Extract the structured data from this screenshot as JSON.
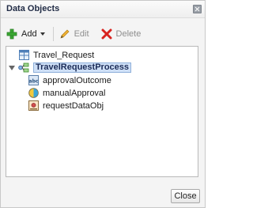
{
  "dialog": {
    "title": "Data Objects"
  },
  "toolbar": {
    "add_label": "Add",
    "edit_label": "Edit",
    "delete_label": "Delete"
  },
  "tree": {
    "items": [
      {
        "label": "Travel_Request",
        "icon": "table-icon",
        "level": 0
      },
      {
        "label": "TravelRequestProcess",
        "icon": "process-icon",
        "level": 0,
        "expanded": true,
        "selected": true
      },
      {
        "label": "approvalOutcome",
        "icon": "string-var-icon",
        "level": 1
      },
      {
        "label": "manualApproval",
        "icon": "boolean-var-icon",
        "level": 1
      },
      {
        "label": "requestDataObj",
        "icon": "business-object-icon",
        "level": 1
      }
    ]
  },
  "footer": {
    "close_label": "Close"
  },
  "colors": {
    "selection_fill": "#cfe0f7",
    "selection_border": "#8fb0da",
    "add_green": "#3aa832",
    "delete_red": "#d8231f"
  }
}
